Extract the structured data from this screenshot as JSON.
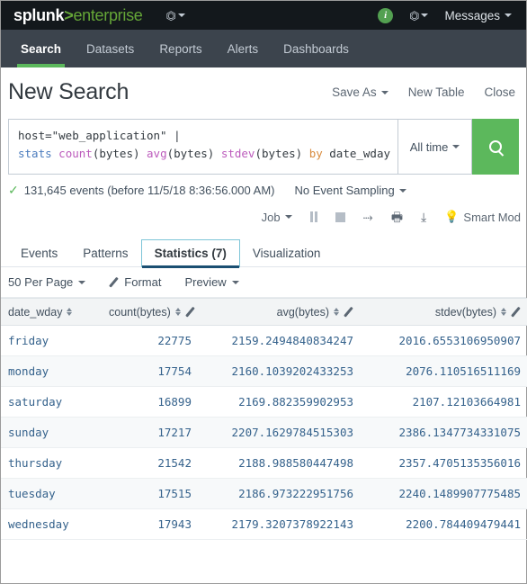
{
  "topbar": {
    "logo_splunk": "splunk",
    "logo_gt": ">",
    "logo_enterprise": "enterprise",
    "nav_caret_icon": "flag-caret-icon",
    "info_badge": "i",
    "right_caret_icon": "flag-caret-icon",
    "messages_label": "Messages"
  },
  "appnav": {
    "items": [
      {
        "label": "Search",
        "active": true
      },
      {
        "label": "Datasets",
        "active": false
      },
      {
        "label": "Reports",
        "active": false
      },
      {
        "label": "Alerts",
        "active": false
      },
      {
        "label": "Dashboards",
        "active": false
      }
    ]
  },
  "pagehead": {
    "title": "New Search",
    "save_as": "Save As",
    "new_table": "New Table",
    "close": "Close"
  },
  "search": {
    "query_line1_plain": "host=\"web_application\" ",
    "query_line1_pipe": "|",
    "query_tokens": {
      "stats": "stats",
      "count": "count",
      "count_arg": "(bytes)",
      "avg": "avg",
      "avg_arg": "(bytes)",
      "stdev": "stdev",
      "stdev_arg": "(bytes)",
      "by": "by",
      "field": "date_wday"
    },
    "time_range": "All time",
    "search_icon": "magnifier-icon"
  },
  "eventsrow": {
    "check_icon": "checkmark-icon",
    "events_text": "131,645 events (before 11/5/18 8:36:56.000 AM)",
    "sampling_label": "No Event Sampling"
  },
  "jobbar": {
    "job_label": "Job",
    "pause_icon": "pause-icon",
    "stop_icon": "stop-icon",
    "share_icon": "share-arrow-icon",
    "print_icon": "print-icon",
    "export_icon": "export-download-icon",
    "mode_icon": "lightbulb-icon",
    "mode_label": "Smart Mod"
  },
  "subtabs": {
    "items": [
      {
        "label": "Events",
        "active": false
      },
      {
        "label": "Patterns",
        "active": false
      },
      {
        "label": "Statistics (7)",
        "active": true
      },
      {
        "label": "Visualization",
        "active": false
      }
    ]
  },
  "fmtbar": {
    "per_page": "50 Per Page",
    "format": "Format",
    "format_icon": "pencil-icon",
    "preview": "Preview"
  },
  "table": {
    "columns": [
      {
        "label": "date_wday",
        "sortable": true,
        "editable": false,
        "numeric": false
      },
      {
        "label": "count(bytes)",
        "sortable": true,
        "editable": true,
        "numeric": true
      },
      {
        "label": "avg(bytes)",
        "sortable": true,
        "editable": true,
        "numeric": true
      },
      {
        "label": "stdev(bytes)",
        "sortable": true,
        "editable": true,
        "numeric": true
      }
    ],
    "rows": [
      {
        "date_wday": "friday",
        "count": "22775",
        "avg": "2159.2494840834247",
        "stdev": "2016.6553106950907"
      },
      {
        "date_wday": "monday",
        "count": "17754",
        "avg": "2160.1039202433253",
        "stdev": "2076.110516511169"
      },
      {
        "date_wday": "saturday",
        "count": "16899",
        "avg": "2169.882359902953",
        "stdev": "2107.12103664981"
      },
      {
        "date_wday": "sunday",
        "count": "17217",
        "avg": "2207.1629784515303",
        "stdev": "2386.1347734331075"
      },
      {
        "date_wday": "thursday",
        "count": "21542",
        "avg": "2188.988580447498",
        "stdev": "2357.4705135356016"
      },
      {
        "date_wday": "tuesday",
        "count": "17515",
        "avg": "2186.973222951756",
        "stdev": "2240.1489907775485"
      },
      {
        "date_wday": "wednesday",
        "count": "17943",
        "avg": "2179.3207378922143",
        "stdev": "2200.784409479441"
      }
    ]
  },
  "colors": {
    "topbar_bg": "#13181c",
    "appnav_bg": "#3c444d",
    "accent_green": "#5cb85c",
    "link_blue": "#35628c",
    "active_tab_border": "#7ec5d8"
  }
}
